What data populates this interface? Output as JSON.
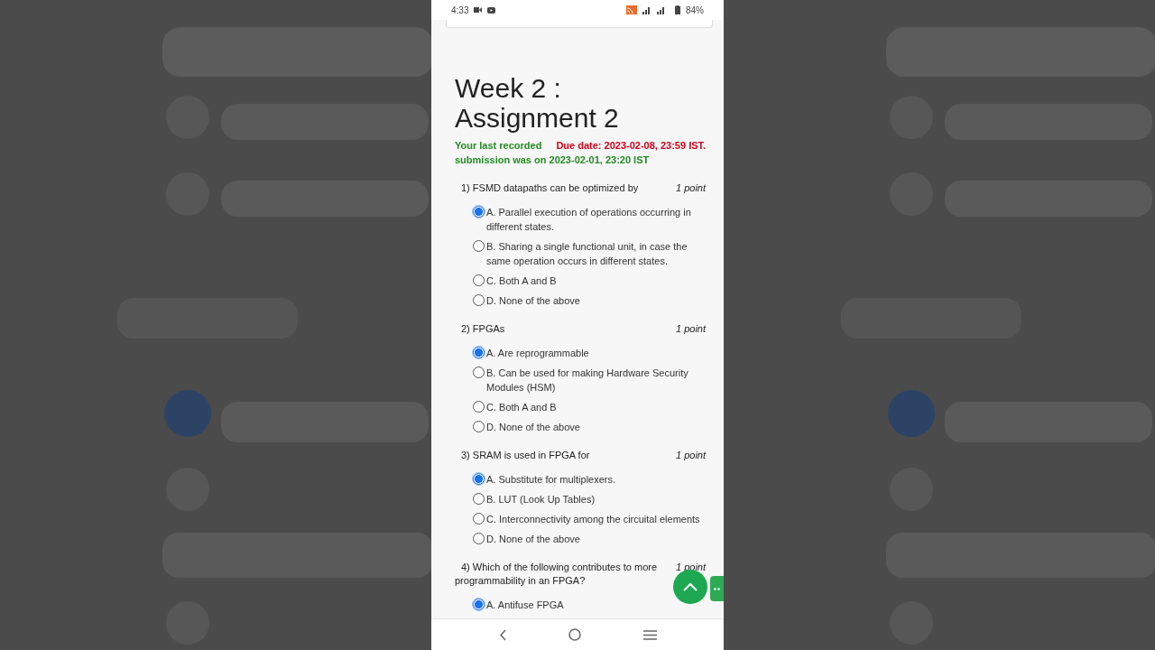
{
  "status_bar": {
    "time": "4:33",
    "battery": "84%"
  },
  "title": "Week 2 : Assignment 2",
  "submission": {
    "recorded": [
      "Your last recorded",
      "submission was on 2023-02-01, 23:20 IST"
    ],
    "due": "Due date: 2023-02-08, 23:59 IST."
  },
  "questions": [
    {
      "number": "1)",
      "text": "FSMD datapaths can be optimized by",
      "points": "1 point",
      "options": [
        {
          "label": "A. Parallel execution of operations occurring in different states.",
          "selected": true
        },
        {
          "label": "B. Sharing a single functional unit, in case the same operation occurs in different states.",
          "selected": false
        },
        {
          "label": "C. Both A and B",
          "selected": false
        },
        {
          "label": "D. None of the above",
          "selected": false
        }
      ]
    },
    {
      "number": "2)",
      "text": "FPGAs",
      "points": "1 point",
      "options": [
        {
          "label": "A. Are reprogrammable",
          "selected": true
        },
        {
          "label": "B. Can be used for making Hardware Security Modules (HSM)",
          "selected": false
        },
        {
          "label": "C. Both A and B",
          "selected": false
        },
        {
          "label": "D. None of the above",
          "selected": false
        }
      ]
    },
    {
      "number": "3)",
      "text": "SRAM is used in FPGA for",
      "points": "1 point",
      "options": [
        {
          "label": "A. Substitute for multiplexers.",
          "selected": true
        },
        {
          "label": "B. LUT (Look Up Tables)",
          "selected": false
        },
        {
          "label": "C. Interconnectivity among the circuital elements",
          "selected": false
        },
        {
          "label": "D. None of the above",
          "selected": false
        }
      ]
    },
    {
      "number": "4)",
      "text": "Which of the following contributes to more programmability in an FPGA?",
      "points": "1 point",
      "options": [
        {
          "label": "A. Antifuse FPGA",
          "selected": true
        }
      ]
    }
  ]
}
